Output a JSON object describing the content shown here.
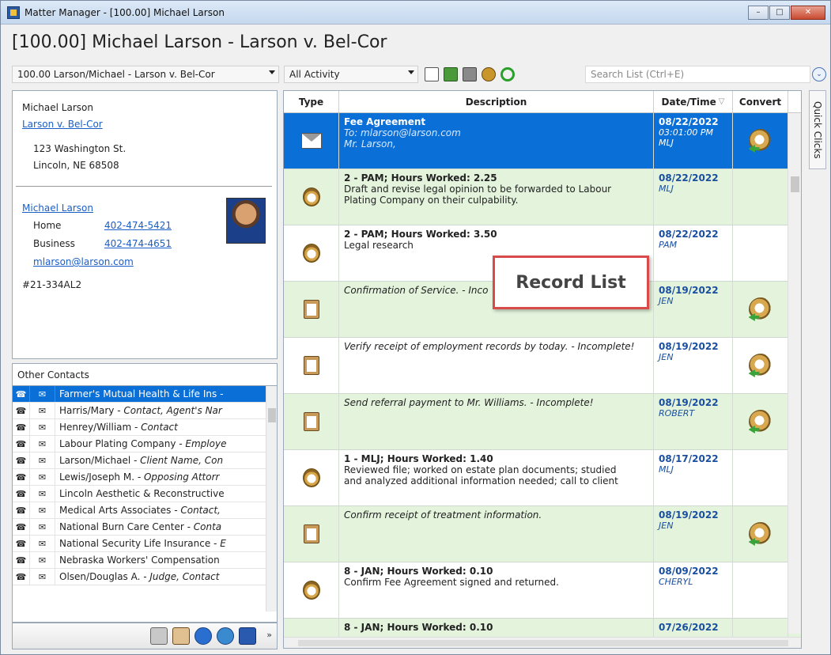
{
  "window": {
    "title": "Matter Manager - [100.00] Michael Larson",
    "minimize": "–",
    "maximize": "□",
    "close": "✕"
  },
  "header": {
    "matter_title": "[100.00] Michael Larson - Larson v. Bel-Cor"
  },
  "toolbar": {
    "matter_select": "100.00 Larson/Michael - Larson v. Bel-Cor",
    "activity_select": "All Activity",
    "search_placeholder": "Search List (Ctrl+E)",
    "expand_icon": "⌄"
  },
  "client": {
    "name": "Michael Larson",
    "case_link": "Larson v. Bel-Cor",
    "address_line1": "123 Washington St.",
    "address_line2": "Lincoln, NE  68508",
    "contact_name": "Michael Larson",
    "home_label": "Home",
    "home_phone": "402-474-5421",
    "business_label": "Business",
    "business_phone": "402-474-4651",
    "email": "mlarson@larson.com",
    "case_number": "#21-334AL2"
  },
  "other_contacts": {
    "header": "Other Contacts",
    "items": [
      {
        "name": "Farmer's Mutual Health & Life Ins",
        "role": " -",
        "selected": true
      },
      {
        "name": "Harris/Mary",
        "role": " - Contact, Agent's Nar",
        "selected": false
      },
      {
        "name": "Henrey/William",
        "role": " - Contact",
        "selected": false
      },
      {
        "name": "Labour Plating Company",
        "role": " - Employe",
        "selected": false
      },
      {
        "name": "Larson/Michael",
        "role": " - Client Name, Con",
        "selected": false
      },
      {
        "name": "Lewis/Joseph M.",
        "role": " - Opposing Attorr",
        "selected": false
      },
      {
        "name": "Lincoln Aesthetic & Reconstructive",
        "role": "",
        "selected": false
      },
      {
        "name": "Medical Arts Associates",
        "role": " - Contact,",
        "selected": false
      },
      {
        "name": "National Burn Care Center",
        "role": " - Conta",
        "selected": false
      },
      {
        "name": "National Security Life Insurance",
        "role": " - E",
        "selected": false
      },
      {
        "name": "Nebraska Workers' Compensation",
        "role": "",
        "selected": false
      },
      {
        "name": "Olsen/Douglas A.",
        "role": " - Judge, Contact",
        "selected": false
      }
    ],
    "more": "»"
  },
  "grid": {
    "headers": {
      "type": "Type",
      "description": "Description",
      "date": "Date/Time",
      "convert": "Convert"
    },
    "rows": [
      {
        "icon": "mail-icon",
        "title": "Fee Agreement",
        "lines": [
          "To:  mlarson@larson.com",
          "Mr. Larson,"
        ],
        "italic": true,
        "date": "08/22/2022",
        "sub": [
          "03:01:00 PM",
          "MLJ"
        ],
        "convert": true,
        "style": "sel"
      },
      {
        "icon": "timer-icon",
        "title": "2 - PAM;  Hours Worked:  2.25",
        "lines": [
          "Draft and revise legal opinion to be forwarded to Labour",
          " Plating Company on their culpability."
        ],
        "italic": false,
        "date": "08/22/2022",
        "sub": [
          "MLJ"
        ],
        "convert": false,
        "style": "green"
      },
      {
        "icon": "timer-icon",
        "title": "2 - PAM;  Hours Worked:  3.50",
        "lines": [
          "Legal research"
        ],
        "italic": false,
        "date": "08/22/2022",
        "sub": [
          "PAM"
        ],
        "convert": false,
        "style": "white"
      },
      {
        "icon": "task-icon",
        "title": "",
        "lines": [
          "Confirmation of Service. - Inco"
        ],
        "italic": true,
        "date": "08/19/2022",
        "sub": [
          "JEN"
        ],
        "convert": true,
        "style": "green"
      },
      {
        "icon": "task-icon",
        "title": "",
        "lines": [
          "Verify receipt of employment records by today. - Incomplete!"
        ],
        "italic": true,
        "date": "08/19/2022",
        "sub": [
          "JEN"
        ],
        "convert": true,
        "style": "white"
      },
      {
        "icon": "task-icon",
        "title": "",
        "lines": [
          "Send referral payment to Mr. Williams. - Incomplete!"
        ],
        "italic": true,
        "date": "08/19/2022",
        "sub": [
          "ROBERT"
        ],
        "convert": true,
        "style": "green"
      },
      {
        "icon": "timer-icon",
        "title": "1 - MLJ;  Hours Worked:  1.40",
        "lines": [
          "Reviewed file; worked on estate plan documents; studied",
          " and analyzed additional information needed; call to client"
        ],
        "italic": false,
        "date": "08/17/2022",
        "sub": [
          "MLJ"
        ],
        "convert": false,
        "style": "white"
      },
      {
        "icon": "task-icon",
        "title": "",
        "lines": [
          "Confirm receipt of treatment information."
        ],
        "italic": true,
        "date": "08/19/2022",
        "sub": [
          "JEN"
        ],
        "convert": true,
        "style": "green"
      },
      {
        "icon": "timer-icon",
        "title": "8 - JAN;  Hours Worked:  0.10",
        "lines": [
          "Confirm Fee Agreement signed and returned."
        ],
        "italic": false,
        "date": "08/09/2022",
        "sub": [
          "CHERYL"
        ],
        "convert": false,
        "style": "white"
      },
      {
        "icon": "timer-icon",
        "title": "8 - JAN;  Hours Worked:  0.10",
        "lines": [],
        "italic": false,
        "date": "07/26/2022",
        "sub": [],
        "convert": false,
        "style": "green"
      }
    ]
  },
  "side_tab": "Quick Clicks",
  "callout": "Record List",
  "colors": {
    "selection": "#0a70d8",
    "green_row": "#e3f3dc",
    "link": "#1a5ec8",
    "callout_border": "#d94a4a"
  }
}
